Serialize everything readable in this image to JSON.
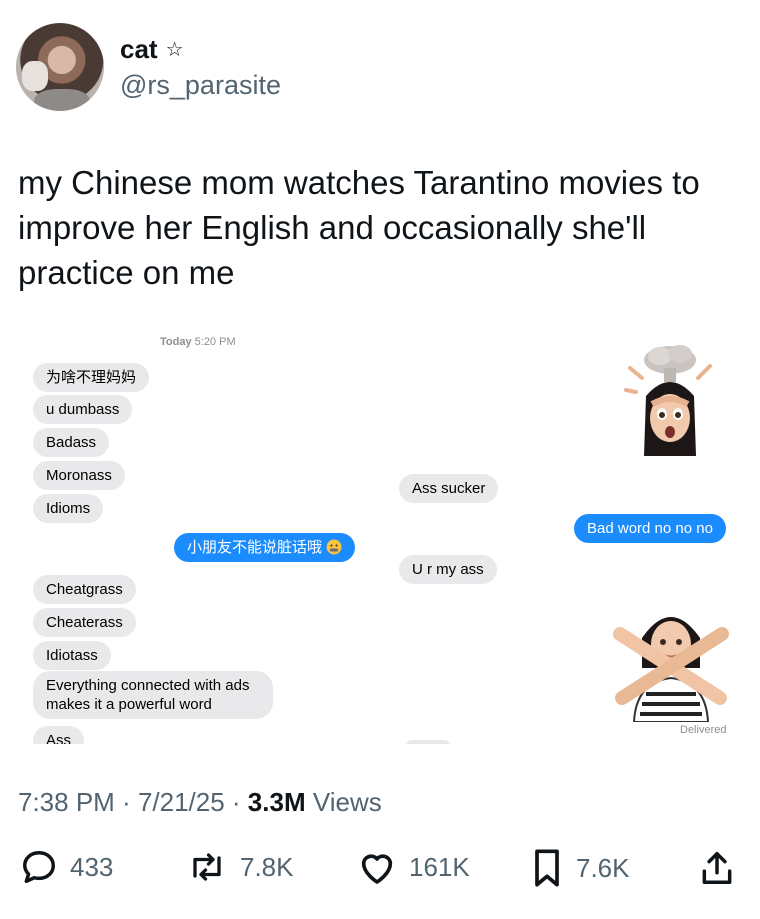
{
  "author": {
    "display_name": "cat",
    "badge_icon": "star-outline-icon",
    "handle": "@rs_parasite"
  },
  "tweet": {
    "text": "my Chinese mom watches Tarantino movies to improve her English and occasionally she'll practice on me"
  },
  "screenshot": {
    "timestamp_day": "Today",
    "timestamp_time": "5:20 PM",
    "messages": [
      {
        "side": "incoming",
        "text": "为啥不理妈妈"
      },
      {
        "side": "incoming",
        "text": "u dumbass"
      },
      {
        "side": "incoming",
        "text": "Badass"
      },
      {
        "side": "incoming",
        "text": "Moronass"
      },
      {
        "side": "incoming",
        "text": "Idioms"
      },
      {
        "side": "outgoing",
        "text": "小朋友不能说脏话哦"
      },
      {
        "side": "incoming",
        "text": "Cheatgrass"
      },
      {
        "side": "incoming",
        "text": "Cheaterass"
      },
      {
        "side": "incoming",
        "text": "Idiotass"
      },
      {
        "side": "incoming",
        "text": "Everything connected with ads makes it a powerful word"
      },
      {
        "side": "incoming",
        "text": "Ass"
      },
      {
        "side": "incoming",
        "text": "Ass sucker"
      },
      {
        "side": "incoming",
        "text": "U r my ass"
      },
      {
        "side": "outgoing",
        "text": "Bad word no no no"
      }
    ],
    "delivered_label": "Delivered"
  },
  "meta": {
    "time": "7:38 PM",
    "date": "7/21/25",
    "views_count": "3.3M",
    "views_label": "Views"
  },
  "actions": {
    "replies": "433",
    "reposts": "7.8K",
    "likes": "161K",
    "bookmarks": "7.6K"
  },
  "colors": {
    "text_primary": "#0f1419",
    "text_secondary": "#536471",
    "imessage_blue": "#1a8cfe",
    "imessage_gray": "#e9e9eb"
  }
}
